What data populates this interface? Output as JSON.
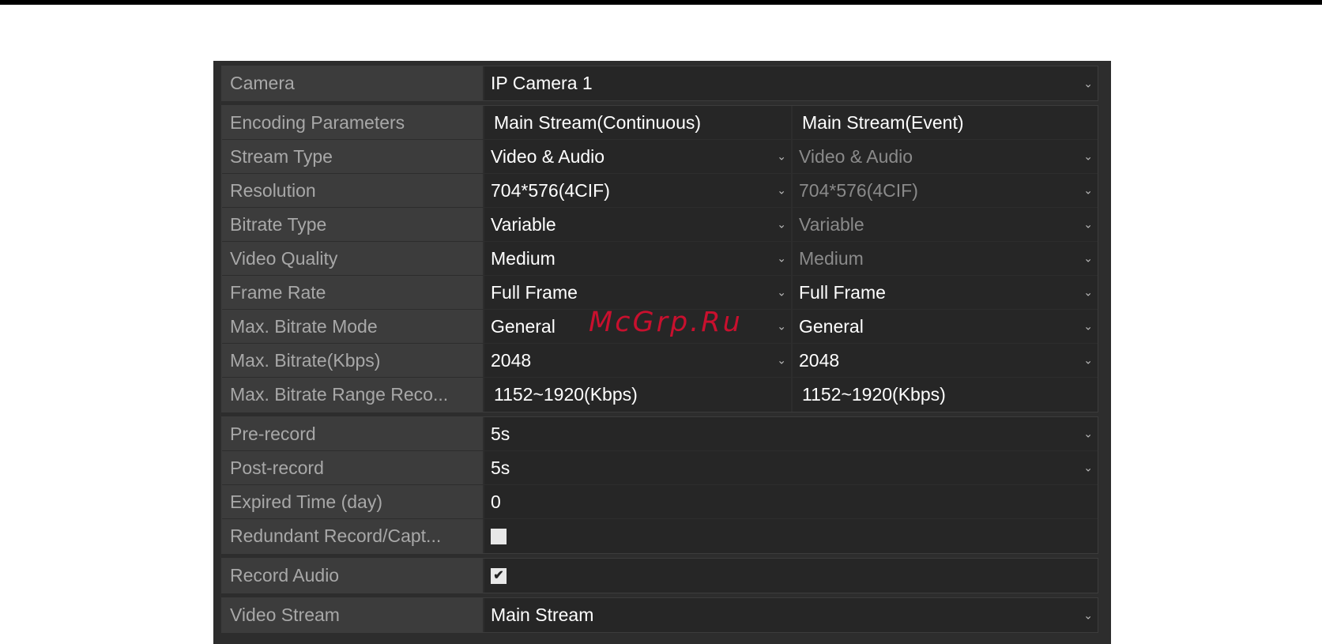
{
  "camera": {
    "label": "Camera",
    "value": "IP Camera 1"
  },
  "encoding": {
    "header": {
      "label": "Encoding Parameters",
      "col1": "Main Stream(Continuous)",
      "col2": "Main Stream(Event)"
    },
    "rows": [
      {
        "label": "Stream Type",
        "col1": "Video & Audio",
        "col2": "Video & Audio"
      },
      {
        "label": "Resolution",
        "col1": "704*576(4CIF)",
        "col2": "704*576(4CIF)"
      },
      {
        "label": "Bitrate Type",
        "col1": "Variable",
        "col2": "Variable"
      },
      {
        "label": "Video Quality",
        "col1": "Medium",
        "col2": "Medium"
      },
      {
        "label": "Frame Rate",
        "col1": "Full Frame",
        "col2": "Full Frame"
      },
      {
        "label": "Max. Bitrate Mode",
        "col1": "General",
        "col2": "General"
      },
      {
        "label": "Max. Bitrate(Kbps)",
        "col1": "2048",
        "col2": "2048"
      },
      {
        "label": "Max. Bitrate Range Reco...",
        "col1": "1152~1920(Kbps)",
        "col2": "1152~1920(Kbps)"
      }
    ]
  },
  "record": {
    "pre_record": {
      "label": "Pre-record",
      "value": "5s"
    },
    "post_record": {
      "label": "Post-record",
      "value": "5s"
    },
    "expired_time": {
      "label": "Expired Time (day)",
      "value": "0"
    },
    "redundant": {
      "label": "Redundant Record/Capt...",
      "checked": false
    }
  },
  "record_audio": {
    "label": "Record Audio",
    "checked": true
  },
  "video_stream": {
    "label": "Video Stream",
    "value": "Main Stream"
  },
  "watermark": "McGrp.Ru",
  "icons": {
    "dropdown": "chevron-down-icon",
    "checkbox": "checkbox-icon"
  },
  "colors": {
    "panel_bg": "#2d2d2d",
    "label_bg": "#3c3c3c",
    "field_bg": "#262626",
    "label_text": "#a8a8a8",
    "disabled_text": "#8a8a8a",
    "watermark": "#c8102e"
  }
}
